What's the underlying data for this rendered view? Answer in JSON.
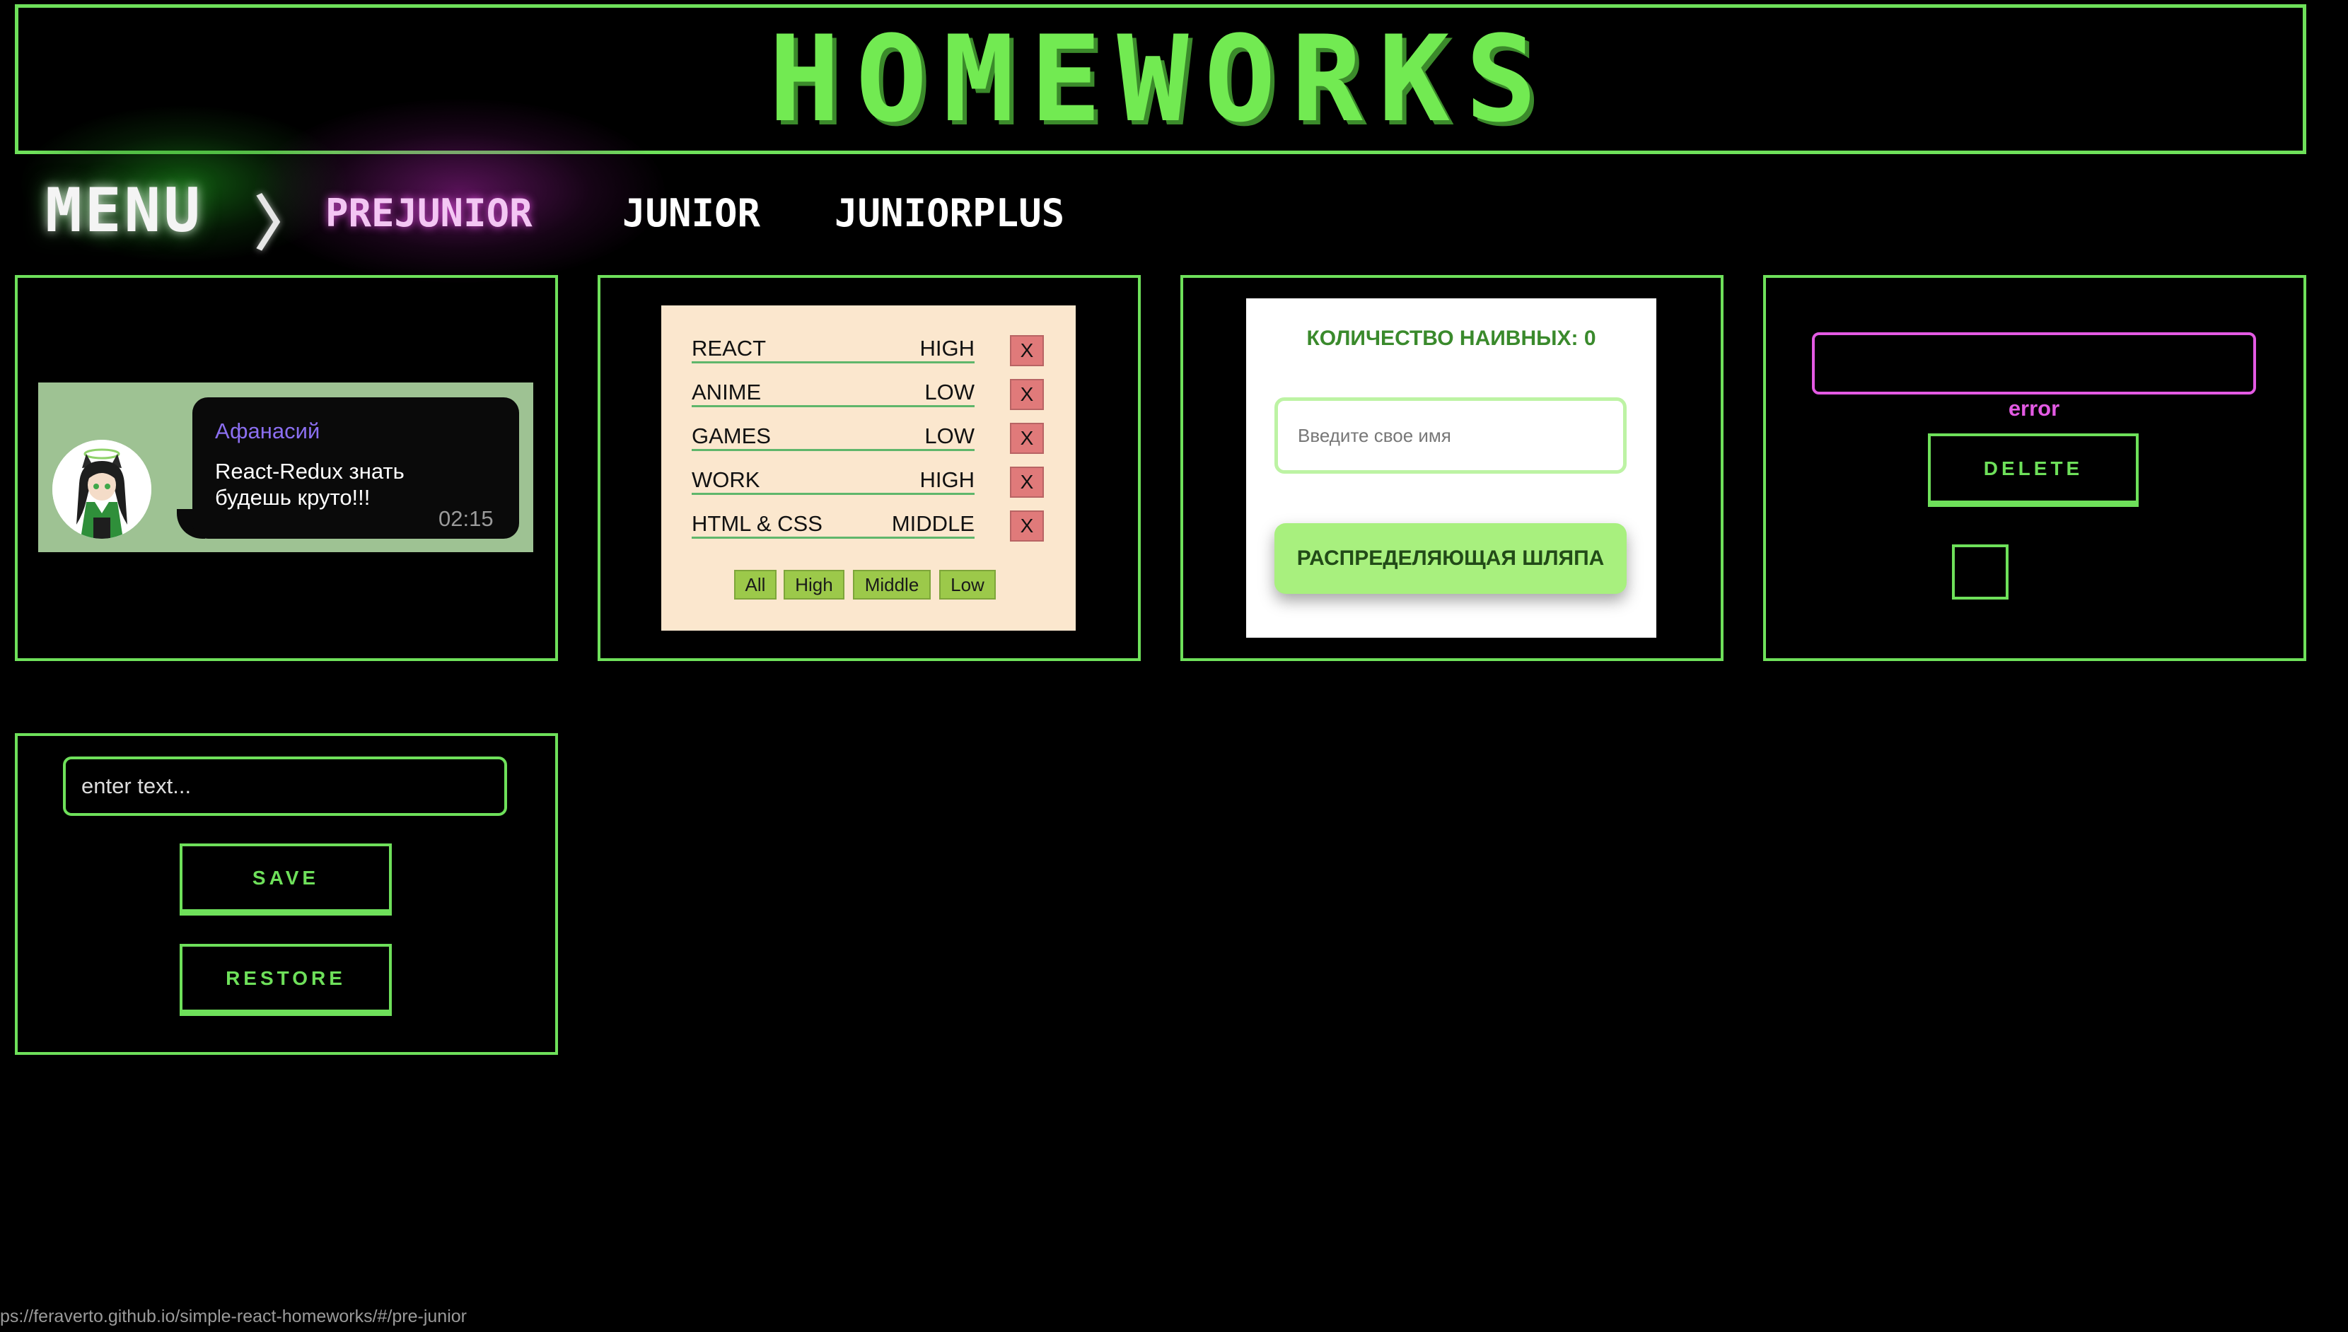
{
  "header": {
    "title": "HOMEWORKS"
  },
  "menu": {
    "label": "MENU",
    "arrow": "〉",
    "items": [
      {
        "label": "PREJUNIOR",
        "active": true
      },
      {
        "label": "JUNIOR",
        "active": false
      },
      {
        "label": "JUNIORPLUS",
        "active": false
      }
    ]
  },
  "message": {
    "name": "Афанасий",
    "text": "React-Redux знать будешь круто!!!",
    "time": "02:15"
  },
  "affairs": {
    "rows": [
      {
        "name": "REACT",
        "priority": "HIGH",
        "delete": "X"
      },
      {
        "name": "ANIME",
        "priority": "LOW",
        "delete": "X"
      },
      {
        "name": "GAMES",
        "priority": "LOW",
        "delete": "X"
      },
      {
        "name": "WORK",
        "priority": "HIGH",
        "delete": "X"
      },
      {
        "name": "HTML & CSS",
        "priority": "MIDDLE",
        "delete": "X"
      }
    ],
    "filters": [
      "All",
      "High",
      "Middle",
      "Low"
    ]
  },
  "greeting": {
    "count_label": "КОЛИЧЕСТВО НАИВНЫХ: 0",
    "input_placeholder": "Введите свое имя",
    "button": "РАСПРЕДЕЛЯЮЩАЯ ШЛЯПА"
  },
  "components": {
    "error_text": "error",
    "delete_button": "DELETE",
    "checkbox_checked": false
  },
  "storage": {
    "input_placeholder": "enter text...",
    "save_button": "SAVE",
    "restore_button": "RESTORE"
  },
  "status_bar": {
    "url": "ps://feraverto.github.io/simple-react-homeworks/#/pre-junior"
  },
  "colors": {
    "accent_green": "#6ee05a",
    "magenta": "#e35ae3",
    "background": "#000000"
  }
}
